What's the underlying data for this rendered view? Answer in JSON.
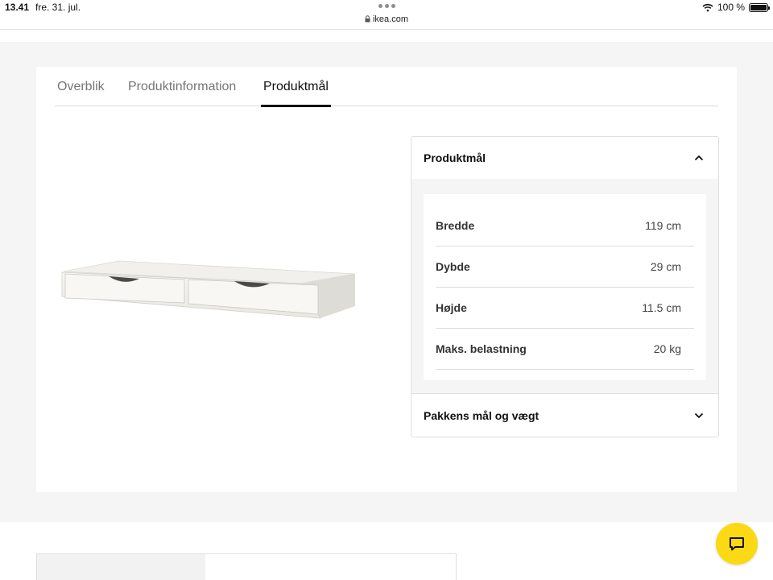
{
  "status_bar": {
    "time": "13.41",
    "date": "fre. 31. jul.",
    "url": "ikea.com",
    "battery": "100 %",
    "battery_level": 1.0
  },
  "tabs": [
    {
      "label": "Overblik",
      "active": false
    },
    {
      "label": "Produktinformation",
      "active": false
    },
    {
      "label": "Produktmål",
      "active": true
    }
  ],
  "dimensions_panel": {
    "title": "Produktmål",
    "expanded": true,
    "rows": [
      {
        "label": "Bredde",
        "value": "119 cm"
      },
      {
        "label": "Dybde",
        "value": "29 cm"
      },
      {
        "label": "Højde",
        "value": "11.5 cm"
      },
      {
        "label": "Maks. belastning",
        "value": "20 kg"
      }
    ]
  },
  "package_panel": {
    "title": "Pakkens mål og vægt",
    "expanded": false
  },
  "colors": {
    "chat_button": "#fbd914",
    "page_background": "#f5f5f5",
    "active_tab_underline": "#111111"
  },
  "icons": {
    "panel_collapse": "chevron-up-icon",
    "panel_expand": "chevron-down-icon",
    "chat": "chat-bubble-icon",
    "lock": "lock-icon",
    "wifi": "wifi-icon",
    "battery": "battery-icon"
  }
}
